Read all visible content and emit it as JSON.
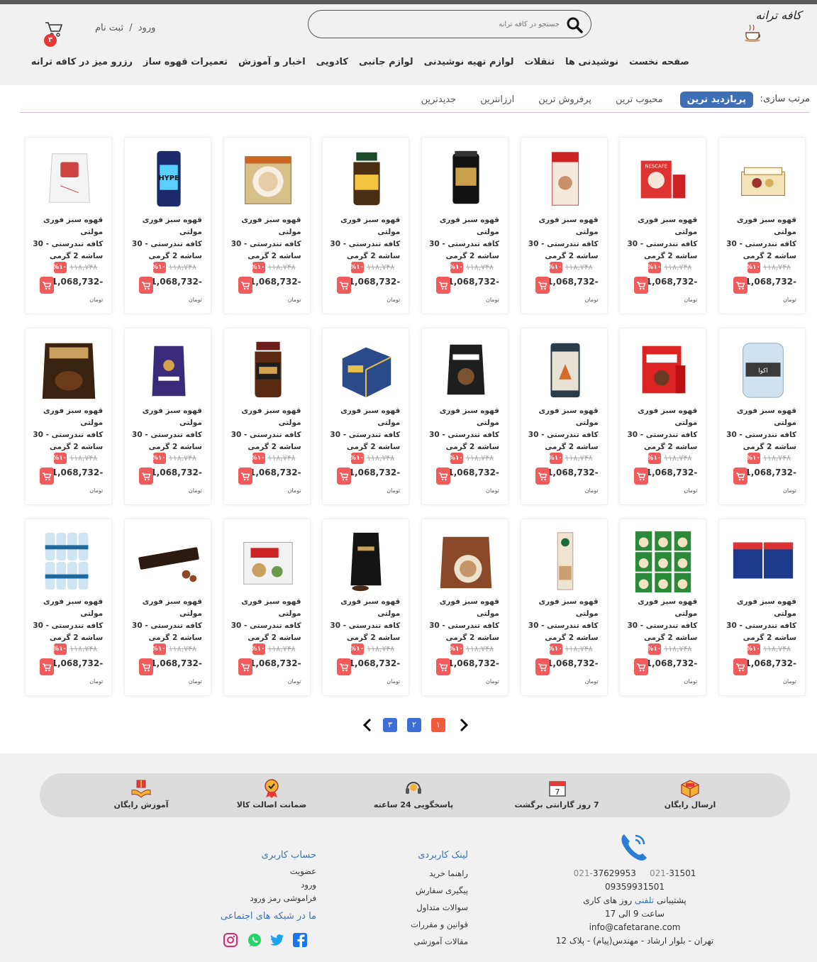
{
  "header": {
    "logo_text": "کافه ترانه",
    "search_placeholder": "جستجو در کافه ترانه",
    "login_label": "ورود",
    "auth_separator": "/",
    "register_label": "ثبت نام",
    "cart_count": "۳"
  },
  "nav": [
    "صفحه نخست",
    "نوشیدنی ها",
    "تنقلات",
    "لوازم تهیه نوشیدنی",
    "لوازم جانبی",
    "کادویی",
    "اخبار و آموزش",
    "تعمیرات قهوه ساز",
    "رزرو میز در کافه ترانه"
  ],
  "sort": {
    "label": "مرتب سازی:",
    "options": [
      "پربازدید ترین",
      "محبوب ترین",
      "پرفروش ترین",
      "ارزانترین",
      "جدیدترین"
    ],
    "active_index": 0
  },
  "product_defaults": {
    "title_line1": "قهوه سبز فوری مولتی",
    "title_line2": "کافه تندرستی - 30",
    "title_line3": "ساشه 2 گرمی",
    "old_price": "۱۱۸,۷۴۸",
    "discount": "%۱۰",
    "price": "1,068,732-",
    "currency": "تومان"
  },
  "products": [
    {
      "image": "tea-box-icon"
    },
    {
      "image": "nescafe-red-box-icon"
    },
    {
      "image": "bonomka-box-icon"
    },
    {
      "image": "multicafe-jar-icon"
    },
    {
      "image": "jacobs-jar-icon"
    },
    {
      "image": "cappuccino-cup-icon"
    },
    {
      "image": "hype-can-icon"
    },
    {
      "image": "white-coffee-bag-icon"
    },
    {
      "image": "water-bottles-icon"
    },
    {
      "image": "nescafe-classic-bag-icon"
    },
    {
      "image": "fox-tin-icon"
    },
    {
      "image": "lavazza-bag-icon"
    },
    {
      "image": "bockstein-box-icon"
    },
    {
      "image": "nescafe-gold-jar-icon"
    },
    {
      "image": "purple-pouch-icon"
    },
    {
      "image": "tims-bag-icon"
    },
    {
      "image": "bonmano-packs-icon"
    },
    {
      "image": "sachet-grid-icon"
    },
    {
      "image": "starbucks-stick-icon"
    },
    {
      "image": "multicafe-bag-icon"
    },
    {
      "image": "black-coffee-bag-icon"
    },
    {
      "image": "tea-gift-box-icon"
    },
    {
      "image": "capsule-sleeve-icon"
    },
    {
      "image": "water-pack-icon"
    }
  ],
  "pagination": {
    "pages": [
      "۱",
      "۲",
      "۳"
    ],
    "active_color": "#f15b3b",
    "inactive_color": "#3d6fd6"
  },
  "features": [
    {
      "label": "ارسال رایگان",
      "icon": "delivery-box-icon"
    },
    {
      "label": "7 روز گارانتی برگشت",
      "icon": "calendar-icon"
    },
    {
      "label": "پاسخگویی 24 ساعته",
      "icon": "headset-icon"
    },
    {
      "label": "ضمانت اصالت کالا",
      "icon": "medal-icon"
    },
    {
      "label": "آموزش رایگان",
      "icon": "gift-hands-icon"
    }
  ],
  "contact": {
    "phone1_prefix": "021-",
    "phone1": "31501",
    "phone2_prefix": "021-",
    "phone2": "37629953",
    "mobile": "09359931501",
    "support_pre": "پشتیبانی",
    "support_hl": "تلفنی",
    "support_post": "روز های کاری",
    "hours": "ساعت 9 الی 17",
    "email": "info@cafetarane.com",
    "address": "تهران - بلوار ارشاد - مهندس(پیام) - پلاک 12"
  },
  "useful_links": {
    "title": "لینک کاربردی",
    "items": [
      "راهنما خرید",
      "پیگیری سفارش",
      "سوالات متداول",
      "قوانین و مقررات",
      "مقالات آموزشی"
    ]
  },
  "account": {
    "title": "حساب کاربری",
    "items": [
      "عضویت",
      "ورود",
      "فراموشی رمز ورود"
    ]
  },
  "social": {
    "title": "ما در شبکه های اجتماعی",
    "items": [
      "facebook-icon",
      "twitter-icon",
      "whatsapp-icon",
      "instagram-icon"
    ]
  },
  "colors": {
    "accent": "#3d6fb6",
    "sale": "#f15b5b",
    "cart_badge": "#e53935"
  }
}
